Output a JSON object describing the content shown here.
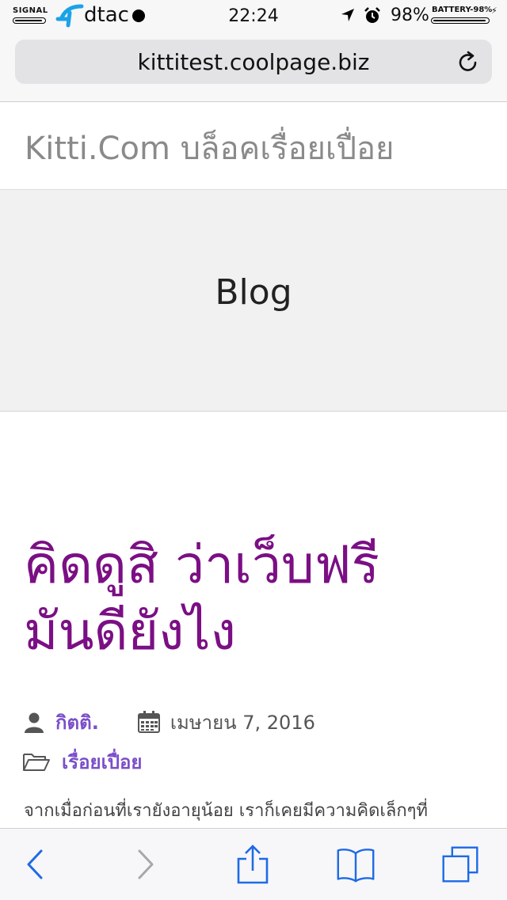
{
  "status_bar": {
    "signal_label": "SIGNAL",
    "carrier": "dtac",
    "time": "22:24",
    "battery_percent": "98%",
    "battery_label": "BATTERY-98%",
    "battery_level": 0.98,
    "icons": [
      "signal-bar",
      "dtac-logo",
      "record-dot",
      "location-arrow-icon",
      "alarm-icon",
      "battery-bar",
      "charging-bolt-icon"
    ]
  },
  "browser": {
    "url": "kittitest.coolpage.biz",
    "reload_icon": "reload-icon",
    "toolbar_icons": [
      "back-icon",
      "forward-icon",
      "share-icon",
      "bookmarks-icon",
      "tabs-icon"
    ]
  },
  "site": {
    "title_latin": "Kitti.Com",
    "title_thai": "บล็อคเรื่อยเปื่อย"
  },
  "hero": {
    "title": "Blog"
  },
  "post": {
    "title_line1": "คิดดูสิ ว่าเว็บฟรี",
    "title_line2": "มันดียังไง",
    "author": "กิตติ.",
    "date": "เมษายน 7, 2016",
    "category": "เรื่อยเปื่อย",
    "excerpt": "จากเมื่อก่อนที่เรายังอายุน้อย เราก็เคยมีความคิดเล็กๆที่"
  },
  "colors": {
    "post_title": "#7b0f84",
    "meta_link": "#7b4fc9",
    "ios_blue": "#1e6ae6"
  }
}
